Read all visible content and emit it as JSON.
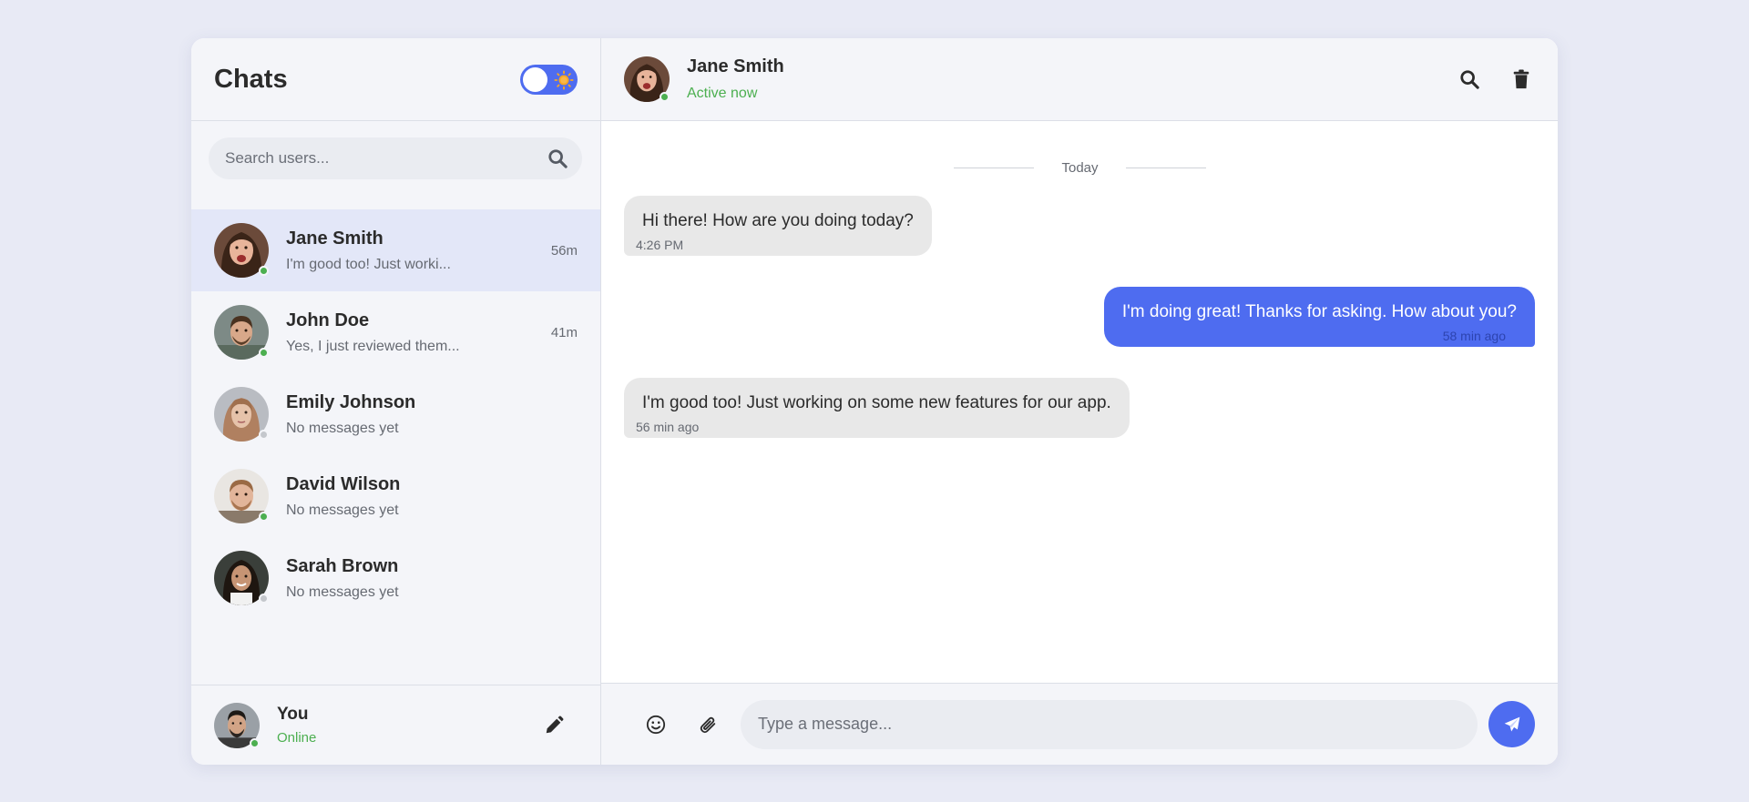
{
  "sidebar": {
    "title": "Chats",
    "search": {
      "placeholder": "Search users..."
    },
    "contacts": [
      {
        "name": "Jane Smith",
        "preview": "I'm good too! Just worki...",
        "time": "56m",
        "status_color": "#4caf50"
      },
      {
        "name": "John Doe",
        "preview": "Yes, I just reviewed them...",
        "time": "41m",
        "status_color": "#4caf50"
      },
      {
        "name": "Emily Johnson",
        "preview": "No messages yet",
        "time": "",
        "status_color": "#c4c7cc"
      },
      {
        "name": "David Wilson",
        "preview": "No messages yet",
        "time": "",
        "status_color": "#4caf50"
      },
      {
        "name": "Sarah Brown",
        "preview": "No messages yet",
        "time": "",
        "status_color": "#c4c7cc"
      }
    ],
    "footer": {
      "name": "You",
      "status": "Online"
    }
  },
  "chat": {
    "header": {
      "name": "Jane Smith",
      "status": "Active now"
    },
    "day_label": "Today",
    "messages": [
      {
        "direction": "in",
        "text": "Hi there! How are you doing today?",
        "time": "4:26 PM"
      },
      {
        "direction": "out",
        "text": "I'm doing great! Thanks for asking. How about you?",
        "time": "58 min ago"
      },
      {
        "direction": "in",
        "text": "I'm good too! Just working on some new features for our app.",
        "time": "56 min ago"
      }
    ],
    "composer": {
      "placeholder": "Type a message..."
    }
  },
  "colors": {
    "accent": "#4e6cf0",
    "online": "#4caf50",
    "offline": "#c4c7cc",
    "active_row": "#e3e7f8"
  },
  "icons": [
    "sun-icon",
    "search-icon",
    "pencil-icon",
    "trash-icon",
    "emoji-icon",
    "paperclip-icon",
    "send-icon"
  ]
}
